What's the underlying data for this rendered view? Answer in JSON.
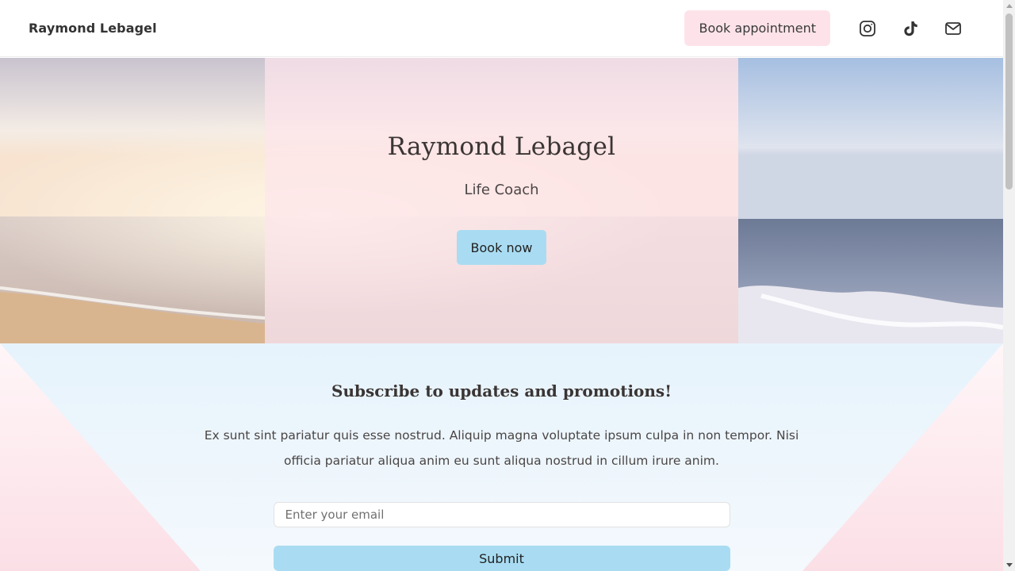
{
  "header": {
    "brand": "Raymond Lebagel",
    "book_appointment_label": "Book appointment",
    "social_icons": [
      "instagram-icon",
      "tiktok-icon",
      "mail-icon"
    ]
  },
  "hero": {
    "title": "Raymond Lebagel",
    "subtitle": "Life Coach",
    "button_label": "Book now"
  },
  "subscribe": {
    "title": "Subscribe to updates and promotions!",
    "text": "Ex sunt sint pariatur quis esse nostrud. Aliquip magna voluptate ipsum culpa in non tempor. Nisi officia pariatur aliqua anim eu sunt aliqua nostrud in cillum irure anim.",
    "email_placeholder": "Enter your email",
    "email_value": "",
    "submit_label": "Submit"
  },
  "colors": {
    "accent_pink": "#fde3e9",
    "accent_blue": "#a9dcf2",
    "section_blue": "#e9f4fc",
    "section_pink": "#fde4ea"
  }
}
